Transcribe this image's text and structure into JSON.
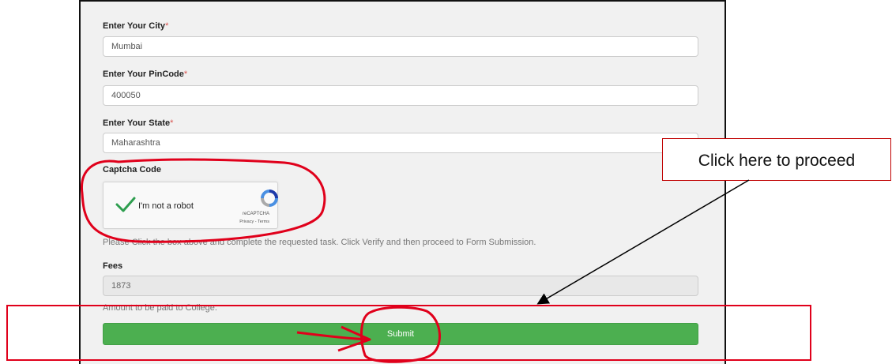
{
  "form": {
    "city": {
      "label": "Enter Your City",
      "required_mark": "*",
      "value": "Mumbai"
    },
    "pincode": {
      "label": "Enter Your PinCode",
      "required_mark": "*",
      "value": "400050"
    },
    "state": {
      "label": "Enter Your State",
      "required_mark": "*",
      "value": "Maharashtra"
    },
    "captcha": {
      "label": "Captcha Code",
      "checkbox_text": "I'm not a robot",
      "brand": "reCAPTCHA",
      "links": "Privacy - Terms",
      "help": "Please Click the box above and complete the requested task. Click Verify and then proceed to Form Submission."
    },
    "fees": {
      "label": "Fees",
      "value": "1873",
      "help": "Amount to be paid to College."
    },
    "submit_label": "Submit"
  },
  "annotations": {
    "callout_text": "Click here to proceed",
    "accent_color": "#e0001b",
    "submit_color": "#4caf50"
  }
}
